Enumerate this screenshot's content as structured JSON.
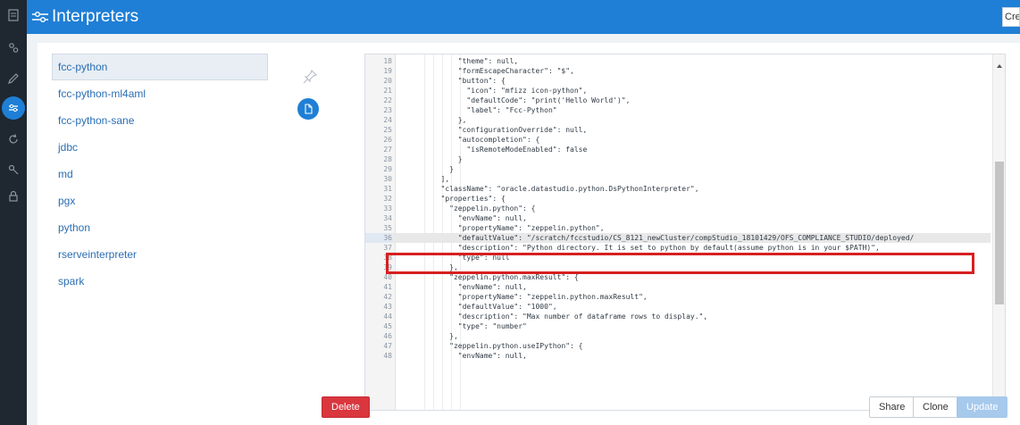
{
  "header": {
    "title": "Interpreters",
    "create_label": "Create"
  },
  "interpreters": [
    "fcc-python",
    "fcc-python-ml4aml",
    "fcc-python-sane",
    "jdbc",
    "md",
    "pgx",
    "python",
    "rserveinterpreter",
    "spark"
  ],
  "selected_interpreter": "fcc-python",
  "editor": {
    "highlighted_line": "36",
    "lines": [
      {
        "n": "18",
        "code": "            \"theme\": null,"
      },
      {
        "n": "19",
        "code": "            \"formEscapeCharacter\": \"$\","
      },
      {
        "n": "20",
        "code": "            \"button\": {"
      },
      {
        "n": "21",
        "code": "              \"icon\": \"mfizz icon-python\","
      },
      {
        "n": "22",
        "code": "              \"defaultCode\": \"print('Hello World')\","
      },
      {
        "n": "23",
        "code": "              \"label\": \"Fcc-Python\""
      },
      {
        "n": "24",
        "code": "            },"
      },
      {
        "n": "25",
        "code": "            \"configurationOverride\": null,"
      },
      {
        "n": "26",
        "code": "            \"autocompletion\": {"
      },
      {
        "n": "27",
        "code": "              \"isRemoteModeEnabled\": false"
      },
      {
        "n": "28",
        "code": "            }"
      },
      {
        "n": "29",
        "code": "          }"
      },
      {
        "n": "30",
        "code": "        ],"
      },
      {
        "n": "31",
        "code": "        \"className\": \"oracle.datastudio.python.DsPythonInterpreter\","
      },
      {
        "n": "32",
        "code": "        \"properties\": {"
      },
      {
        "n": "33",
        "code": "          \"zeppelin.python\": {"
      },
      {
        "n": "34",
        "code": "            \"envName\": null,"
      },
      {
        "n": "35",
        "code": "            \"propertyName\": \"zeppelin.python\","
      },
      {
        "n": "36",
        "code": "            \"defaultValue\": \"/scratch/fccstudio/CS_8121_newCluster/compStudio_18101429/OFS_COMPLIANCE_STUDIO/deployed/"
      },
      {
        "n": "37",
        "code": "            \"description\": \"Python directory. It is set to python by default(assume python is in your $PATH)\","
      },
      {
        "n": "38",
        "code": "            \"type\": null"
      },
      {
        "n": "39",
        "code": "          },"
      },
      {
        "n": "40",
        "code": "          \"zeppelin.python.maxResult\": {"
      },
      {
        "n": "41",
        "code": "            \"envName\": null,"
      },
      {
        "n": "42",
        "code": "            \"propertyName\": \"zeppelin.python.maxResult\","
      },
      {
        "n": "43",
        "code": "            \"defaultValue\": \"1000\","
      },
      {
        "n": "44",
        "code": "            \"description\": \"Max number of dataframe rows to display.\","
      },
      {
        "n": "45",
        "code": "            \"type\": \"number\""
      },
      {
        "n": "46",
        "code": "          },"
      },
      {
        "n": "47",
        "code": "          \"zeppelin.python.useIPython\": {"
      },
      {
        "n": "48",
        "code": "            \"envName\": null,"
      }
    ]
  },
  "buttons": {
    "delete": "Delete",
    "share": "Share",
    "clone": "Clone",
    "update": "Update"
  },
  "colors": {
    "brand": "#1f7fd6",
    "danger": "#d9363e",
    "highlight_box": "#d71f1f",
    "link": "#2a6eb3",
    "sidebar": "#1f2730"
  },
  "icons": [
    "list-icon",
    "users-icon",
    "pencil-icon",
    "interpreter-sliders-icon",
    "refresh-icon",
    "key-icon",
    "lock-icon",
    "pin-icon",
    "document-icon"
  ]
}
